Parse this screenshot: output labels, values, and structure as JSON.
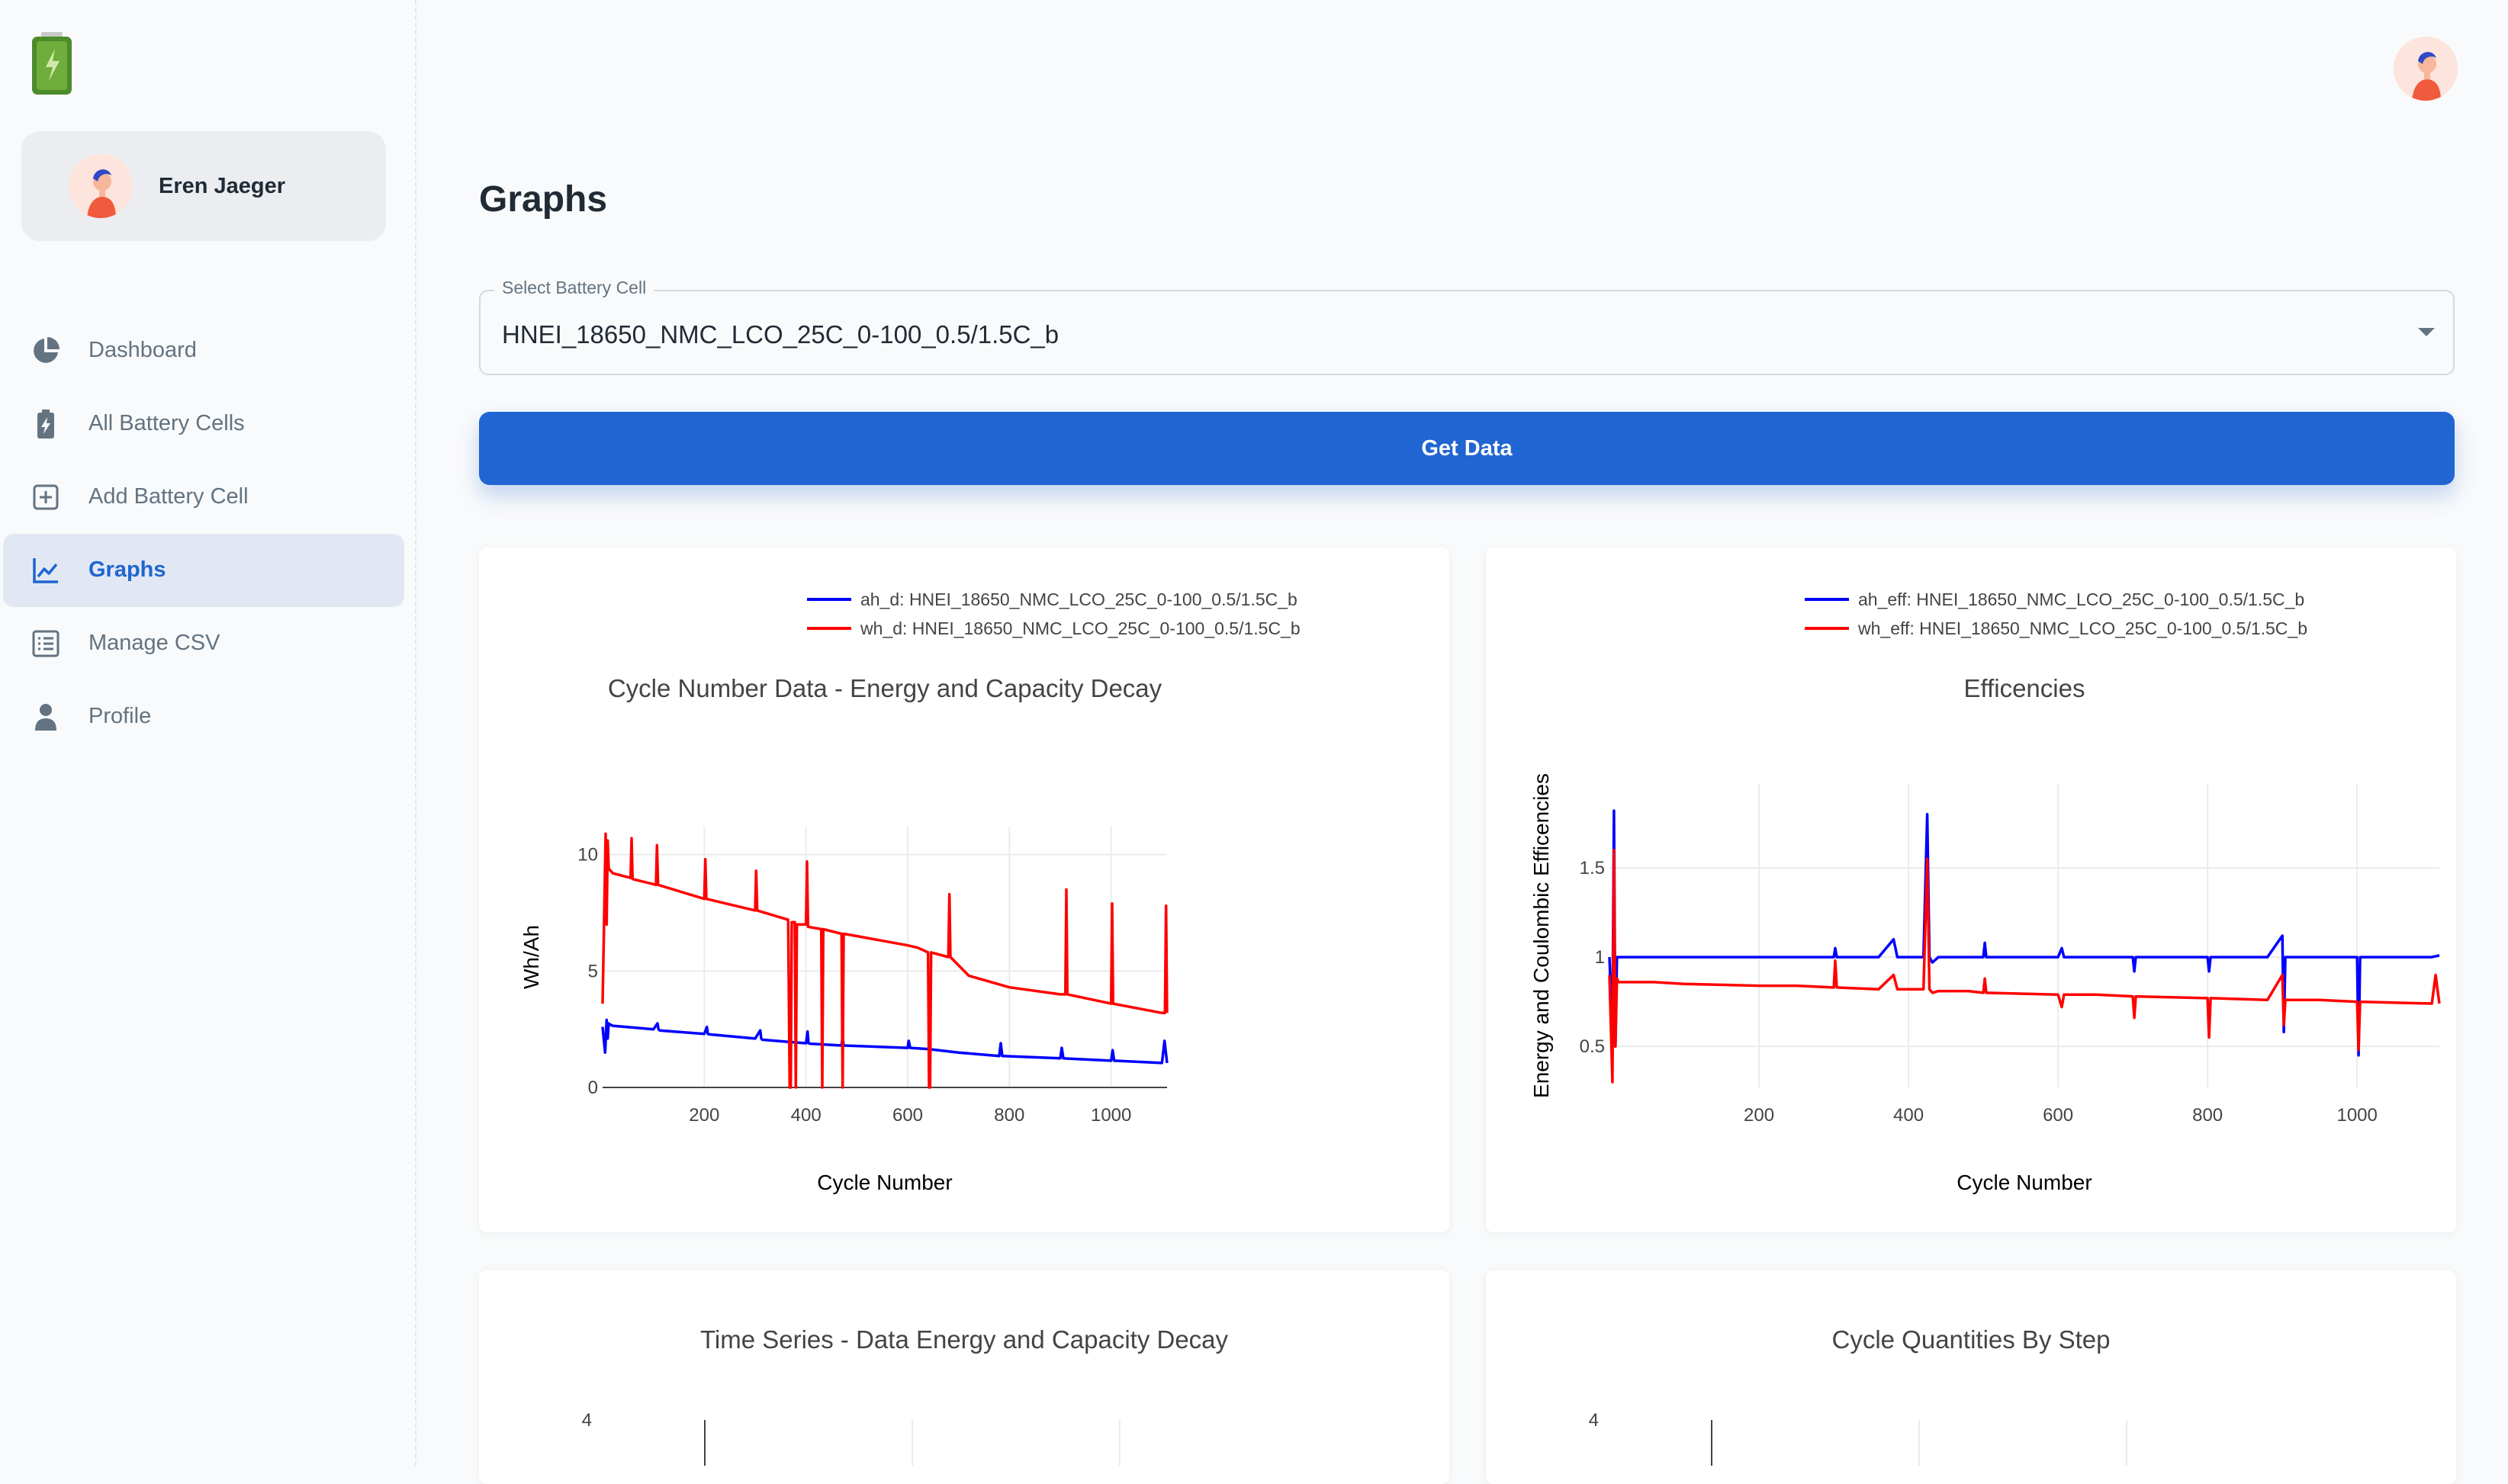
{
  "app": {
    "user_name": "Eren Jaeger"
  },
  "colors": {
    "primary": "#2065d1",
    "series_blue": "#0000ff",
    "series_red": "#ff0000"
  },
  "nav": [
    {
      "label": "Dashboard",
      "icon": "pie-chart-icon"
    },
    {
      "label": "All Battery Cells",
      "icon": "battery-icon"
    },
    {
      "label": "Add Battery Cell",
      "icon": "plus-square-icon"
    },
    {
      "label": "Graphs",
      "icon": "chart-line-icon",
      "active": true
    },
    {
      "label": "Manage CSV",
      "icon": "list-icon"
    },
    {
      "label": "Profile",
      "icon": "person-icon"
    }
  ],
  "page": {
    "title": "Graphs",
    "select_label": "Select Battery Cell",
    "select_value": "HNEI_18650_NMC_LCO_25C_0-100_0.5/1.5C_b",
    "button_label": "Get Data"
  },
  "chart_data": [
    {
      "type": "line",
      "title": "Cycle Number Data - Energy and Capacity Decay",
      "xlabel": "Cycle Number",
      "ylabel": "Wh/Ah",
      "xlim": [
        0,
        1110
      ],
      "ylim": [
        0,
        11.2
      ],
      "xticks": [
        200,
        400,
        600,
        800,
        1000
      ],
      "yticks": [
        0,
        5,
        10
      ],
      "grid": true,
      "legend": "top-right",
      "series": [
        {
          "name": "ah_d: HNEI_18650_NMC_LCO_25C_0-100_0.5/1.5C_b",
          "color": "#0000ff",
          "x": [
            0,
            5,
            8,
            10,
            12,
            15,
            20,
            100,
            108,
            110,
            112,
            200,
            205,
            207,
            210,
            300,
            310,
            312,
            314,
            370,
            400,
            403,
            405,
            408,
            470,
            472,
            474,
            600,
            602,
            605,
            640,
            700,
            780,
            783,
            786,
            900,
            903,
            906,
            1000,
            1003,
            1006,
            1100,
            1105,
            1110
          ],
          "values": [
            2.6,
            1.5,
            2.9,
            2.1,
            2.75,
            2.7,
            2.65,
            2.5,
            2.75,
            2.5,
            2.45,
            2.3,
            2.6,
            2.3,
            2.28,
            2.1,
            2.45,
            2.1,
            2.05,
            1.95,
            1.9,
            2.4,
            1.9,
            1.88,
            1.8,
            2.2,
            1.8,
            1.7,
            2.0,
            1.7,
            1.65,
            1.5,
            1.35,
            1.9,
            1.35,
            1.25,
            1.7,
            1.25,
            1.15,
            1.6,
            1.15,
            1.05,
            2.0,
            1.05
          ]
        },
        {
          "name": "wh_d: HNEI_18650_NMC_LCO_25C_0-100_0.5/1.5C_b",
          "color": "#ff0000",
          "x": [
            0,
            4,
            6,
            8,
            10,
            12,
            16,
            20,
            55,
            57,
            59,
            105,
            107,
            109,
            200,
            202,
            204,
            300,
            302,
            304,
            365,
            368,
            370,
            372,
            378,
            380,
            382,
            400,
            402,
            404,
            430,
            432,
            434,
            470,
            472,
            474,
            500,
            600,
            620,
            640,
            642,
            644,
            646,
            680,
            682,
            684,
            720,
            800,
            900,
            910,
            912,
            914,
            1000,
            1002,
            1004,
            1100,
            1106,
            1108,
            1110
          ],
          "values": [
            3.6,
            8.5,
            10.9,
            7.0,
            10.6,
            9.4,
            9.3,
            9.2,
            9.0,
            10.7,
            8.95,
            8.7,
            10.4,
            8.7,
            8.1,
            9.8,
            8.1,
            7.6,
            9.3,
            7.6,
            7.2,
            0,
            0,
            7.1,
            7.1,
            0,
            7.0,
            7.0,
            9.7,
            6.9,
            6.8,
            0,
            6.8,
            6.6,
            0,
            6.6,
            6.5,
            6.1,
            6.0,
            5.8,
            0,
            0,
            5.8,
            5.6,
            8.3,
            5.6,
            4.8,
            4.3,
            4.0,
            4.0,
            8.5,
            4.0,
            3.6,
            7.9,
            3.6,
            3.2,
            3.2,
            7.8,
            3.2
          ]
        }
      ]
    },
    {
      "type": "line",
      "title": "Efficencies",
      "xlabel": "Cycle Number",
      "ylabel": "Energy and Coulombic Efficencies",
      "xlim": [
        0,
        1110
      ],
      "ylim": [
        0.27,
        1.97
      ],
      "xticks": [
        200,
        400,
        600,
        800,
        1000
      ],
      "yticks": [
        0.5,
        1,
        1.5
      ],
      "grid": true,
      "legend": "top-right",
      "series": [
        {
          "name": "ah_eff: HNEI_18650_NMC_LCO_25C_0-100_0.5/1.5C_b",
          "color": "#0000ff",
          "x": [
            0,
            4,
            6,
            8,
            10,
            12,
            14,
            60,
            100,
            180,
            250,
            300,
            302,
            304,
            360,
            380,
            385,
            400,
            420,
            425,
            428,
            432,
            440,
            480,
            500,
            502,
            504,
            600,
            605,
            608,
            650,
            700,
            702,
            704,
            800,
            802,
            804,
            880,
            900,
            902,
            904,
            950,
            1000,
            1002,
            1004,
            1100,
            1110
          ],
          "values": [
            1.0,
            0.55,
            1.82,
            0.5,
            1.0,
            1.0,
            1.0,
            1.0,
            1.0,
            1.0,
            1.0,
            1.0,
            1.05,
            1.0,
            1.0,
            1.1,
            1.0,
            1.0,
            1.0,
            1.8,
            1.0,
            0.97,
            1.0,
            1.0,
            1.0,
            1.08,
            1.0,
            1.0,
            1.05,
            1.0,
            1.0,
            1.0,
            0.92,
            1.0,
            1.0,
            0.92,
            1.0,
            1.0,
            1.12,
            0.58,
            1.0,
            1.0,
            1.0,
            0.45,
            1.0,
            1.0,
            1.01
          ]
        },
        {
          "name": "wh_eff: HNEI_18650_NMC_LCO_25C_0-100_0.5/1.5C_b",
          "color": "#ff0000",
          "x": [
            0,
            4,
            6,
            8,
            10,
            12,
            14,
            60,
            100,
            200,
            250,
            300,
            302,
            304,
            360,
            380,
            385,
            400,
            420,
            425,
            428,
            432,
            440,
            480,
            500,
            502,
            504,
            600,
            605,
            608,
            650,
            700,
            702,
            704,
            800,
            802,
            804,
            880,
            900,
            902,
            904,
            950,
            1000,
            1002,
            1004,
            1100,
            1105,
            1110
          ],
          "values": [
            0.9,
            0.3,
            1.6,
            0.5,
            0.88,
            0.86,
            0.86,
            0.86,
            0.85,
            0.84,
            0.84,
            0.83,
            0.98,
            0.83,
            0.82,
            0.9,
            0.82,
            0.82,
            0.82,
            1.55,
            0.82,
            0.8,
            0.81,
            0.81,
            0.8,
            0.88,
            0.8,
            0.79,
            0.72,
            0.79,
            0.79,
            0.78,
            0.66,
            0.78,
            0.77,
            0.55,
            0.77,
            0.76,
            0.9,
            0.62,
            0.76,
            0.76,
            0.75,
            0.48,
            0.75,
            0.74,
            0.9,
            0.74
          ]
        }
      ]
    },
    {
      "type": "line",
      "title": "Time Series - Data Energy and Capacity Decay",
      "yticks": [
        4
      ]
    },
    {
      "type": "line",
      "title": "Cycle Quantities By Step",
      "yticks": [
        4
      ]
    }
  ]
}
